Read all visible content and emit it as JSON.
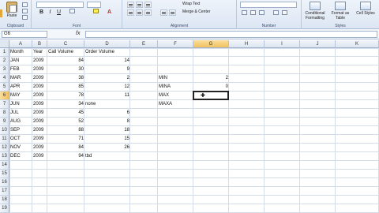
{
  "ribbon": {
    "clipboard": {
      "paste_label": "Paste",
      "group_label": "Clipboard"
    },
    "font": {
      "group_label": "Font",
      "bold": "B",
      "italic": "I",
      "underline": "U",
      "font_color": "A"
    },
    "alignment": {
      "group_label": "Alignment",
      "merge_label": "Merge & Center",
      "wrap_label": "Wrap Text"
    },
    "number": {
      "group_label": "Number"
    },
    "styles": {
      "group_label": "Styles",
      "conditional": "Conditional Formatting",
      "format_table": "Format as Table",
      "cell_styles": "Cell Styles"
    }
  },
  "formula_bar": {
    "name_box": "G6",
    "fx": "fx",
    "formula": ""
  },
  "columns": [
    "A",
    "B",
    "C",
    "D",
    "E",
    "F",
    "G",
    "H",
    "I",
    "J",
    "K"
  ],
  "rows": [
    "1",
    "2",
    "3",
    "4",
    "5",
    "6",
    "7",
    "8",
    "9",
    "10",
    "11",
    "12",
    "13",
    "14",
    "15",
    "16",
    "17",
    "18",
    "19"
  ],
  "cells": {
    "header": {
      "month": "Month",
      "year": "Year",
      "call_volume": "Call Volume",
      "order_volume": "Order Volume"
    },
    "data": [
      {
        "month": "JAN",
        "year": "2009",
        "call": "84",
        "order": "14",
        "note": ""
      },
      {
        "month": "FEB",
        "year": "2009",
        "call": "30",
        "order": "9",
        "note": ""
      },
      {
        "month": "MAR",
        "year": "2009",
        "call": "38",
        "order": "2",
        "note": ""
      },
      {
        "month": "APR",
        "year": "2009",
        "call": "85",
        "order": "12",
        "note": ""
      },
      {
        "month": "MAY",
        "year": "2009",
        "call": "78",
        "order": "11",
        "note": ""
      },
      {
        "month": "JUN",
        "year": "2009",
        "call": "34",
        "order": "",
        "note": "none"
      },
      {
        "month": "JUL",
        "year": "2009",
        "call": "45",
        "order": "6",
        "note": ""
      },
      {
        "month": "AUG",
        "year": "2009",
        "call": "52",
        "order": "8",
        "note": ""
      },
      {
        "month": "SEP",
        "year": "2009",
        "call": "88",
        "order": "18",
        "note": ""
      },
      {
        "month": "OCT",
        "year": "2009",
        "call": "71",
        "order": "15",
        "note": ""
      },
      {
        "month": "NOV",
        "year": "2009",
        "call": "84",
        "order": "26",
        "note": ""
      },
      {
        "month": "DEC",
        "year": "2009",
        "call": "94",
        "order": "",
        "note": "tbd"
      }
    ],
    "stats": [
      {
        "label": "MIN",
        "value": "2"
      },
      {
        "label": "MINA",
        "value": "0"
      },
      {
        "label": "MAX",
        "value": ""
      },
      {
        "label": "MAXA",
        "value": ""
      }
    ]
  },
  "selection": {
    "cell": "G6"
  }
}
